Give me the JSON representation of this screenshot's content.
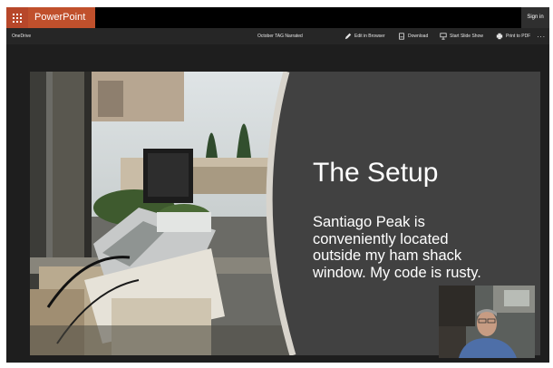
{
  "header": {
    "app_name": "PowerPoint",
    "signin_label": "Sign in",
    "waffle_icon": "app-launcher-icon",
    "accent": "#c0502c"
  },
  "toolbar": {
    "breadcrumb": "OneDrive",
    "document_name": "October TAG Narrated",
    "edit_label": "Edit in Browser",
    "download_label": "Download",
    "slideshow_label": "Start Slide Show",
    "print_label": "Print to PDF",
    "more_label": "..."
  },
  "slide": {
    "title": "The Setup",
    "body_lines": [
      "Santiago Peak is",
      "conveniently located",
      "outside my ham shack",
      "window.  My code is rusty."
    ],
    "background": "#414141"
  }
}
